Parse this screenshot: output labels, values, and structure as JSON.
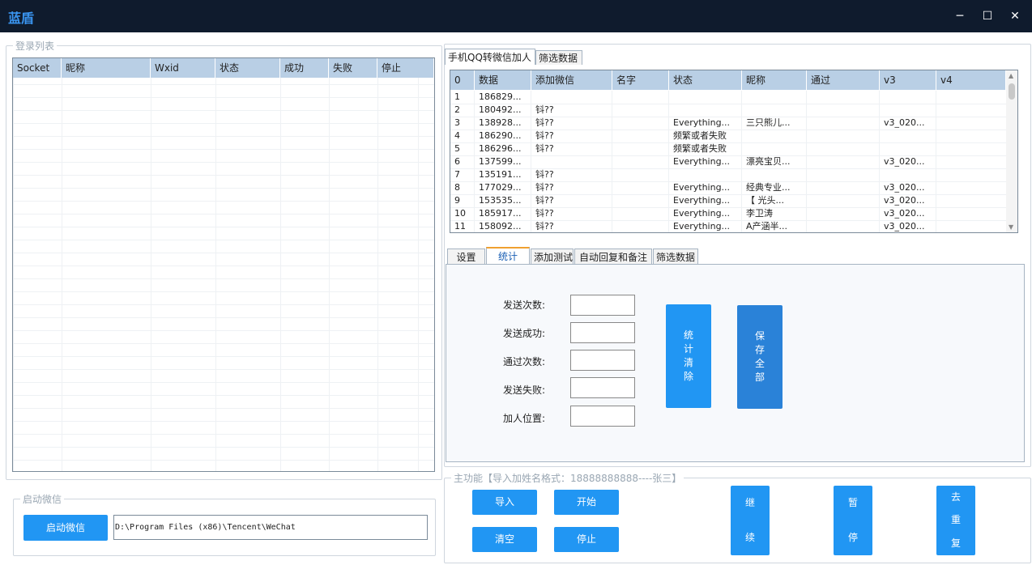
{
  "window": {
    "title": "蓝盾",
    "minimize": "─",
    "maximize": "☐",
    "close": "✕"
  },
  "login_group": {
    "label": "登录列表",
    "columns": [
      "Socket",
      "昵称",
      "Wxid",
      "状态",
      "成功",
      "失败",
      "停止"
    ]
  },
  "start_group": {
    "label": "启动微信",
    "button": "启动微信",
    "path": "D:\\Program Files (x86)\\Tencent\\WeChat"
  },
  "top_tabs": [
    "手机QQ转微信加人",
    "筛选数据"
  ],
  "data_table": {
    "columns": [
      "0",
      "数据",
      "添加微信",
      "名字",
      "状态",
      "昵称",
      "通过",
      "v3",
      "v4"
    ],
    "rows": [
      [
        "1",
        "186829...",
        "",
        "",
        "",
        "",
        "",
        "",
        ""
      ],
      [
        "2",
        "180492...",
        "钭??",
        "",
        "",
        "",
        "",
        "",
        ""
      ],
      [
        "3",
        "138928...",
        "钭??",
        "",
        "Everything...",
        "三只熊儿...",
        "",
        "v3_020...",
        ""
      ],
      [
        "4",
        "186290...",
        "钭??",
        "",
        "频繁或者失败",
        "",
        "",
        "",
        ""
      ],
      [
        "5",
        "186296...",
        "钭??",
        "",
        "频繁或者失败",
        "",
        "",
        "",
        ""
      ],
      [
        "6",
        "137599...",
        "",
        "",
        "Everything...",
        "漂亮宝贝...",
        "",
        "v3_020...",
        ""
      ],
      [
        "7",
        "135191...",
        "钭??",
        "",
        "",
        "",
        "",
        "",
        ""
      ],
      [
        "8",
        "177029...",
        "钭??",
        "",
        "Everything...",
        "经典专业...",
        "",
        "v3_020...",
        ""
      ],
      [
        "9",
        "153535...",
        "钭??",
        "",
        "Everything...",
        "【 光头...",
        "",
        "v3_020...",
        ""
      ],
      [
        "10",
        "185917...",
        "钭??",
        "",
        "Everything...",
        "李卫涛",
        "",
        "v3_020...",
        ""
      ],
      [
        "11",
        "158092...",
        "钭??",
        "",
        "Everything...",
        "A产涵半...",
        "",
        "v3_020...",
        ""
      ]
    ]
  },
  "mid_tabs": [
    "设置",
    "统计",
    "添加测试",
    "自动回复和备注",
    "筛选数据"
  ],
  "stats": {
    "labels": [
      "发送次数:",
      "发送成功:",
      "通过次数:",
      "发送失败:",
      "加人位置:"
    ],
    "clear_button": [
      "统",
      "计",
      "清",
      "除"
    ],
    "save_button": [
      "保",
      "存",
      "全",
      "部"
    ]
  },
  "main_group": {
    "label": "主功能【导入加姓名格式：18888888888----张三】",
    "import": "导入",
    "start": "开始",
    "clear": "清空",
    "stop": "停止",
    "continue": [
      "继",
      "续"
    ],
    "pause": [
      "暂",
      "停"
    ],
    "dedupe": [
      "去",
      "重",
      "复"
    ]
  },
  "colors": {
    "accent": "#2196f3",
    "titlebar": "#0f1b2d",
    "header": "#b9cfe5"
  }
}
